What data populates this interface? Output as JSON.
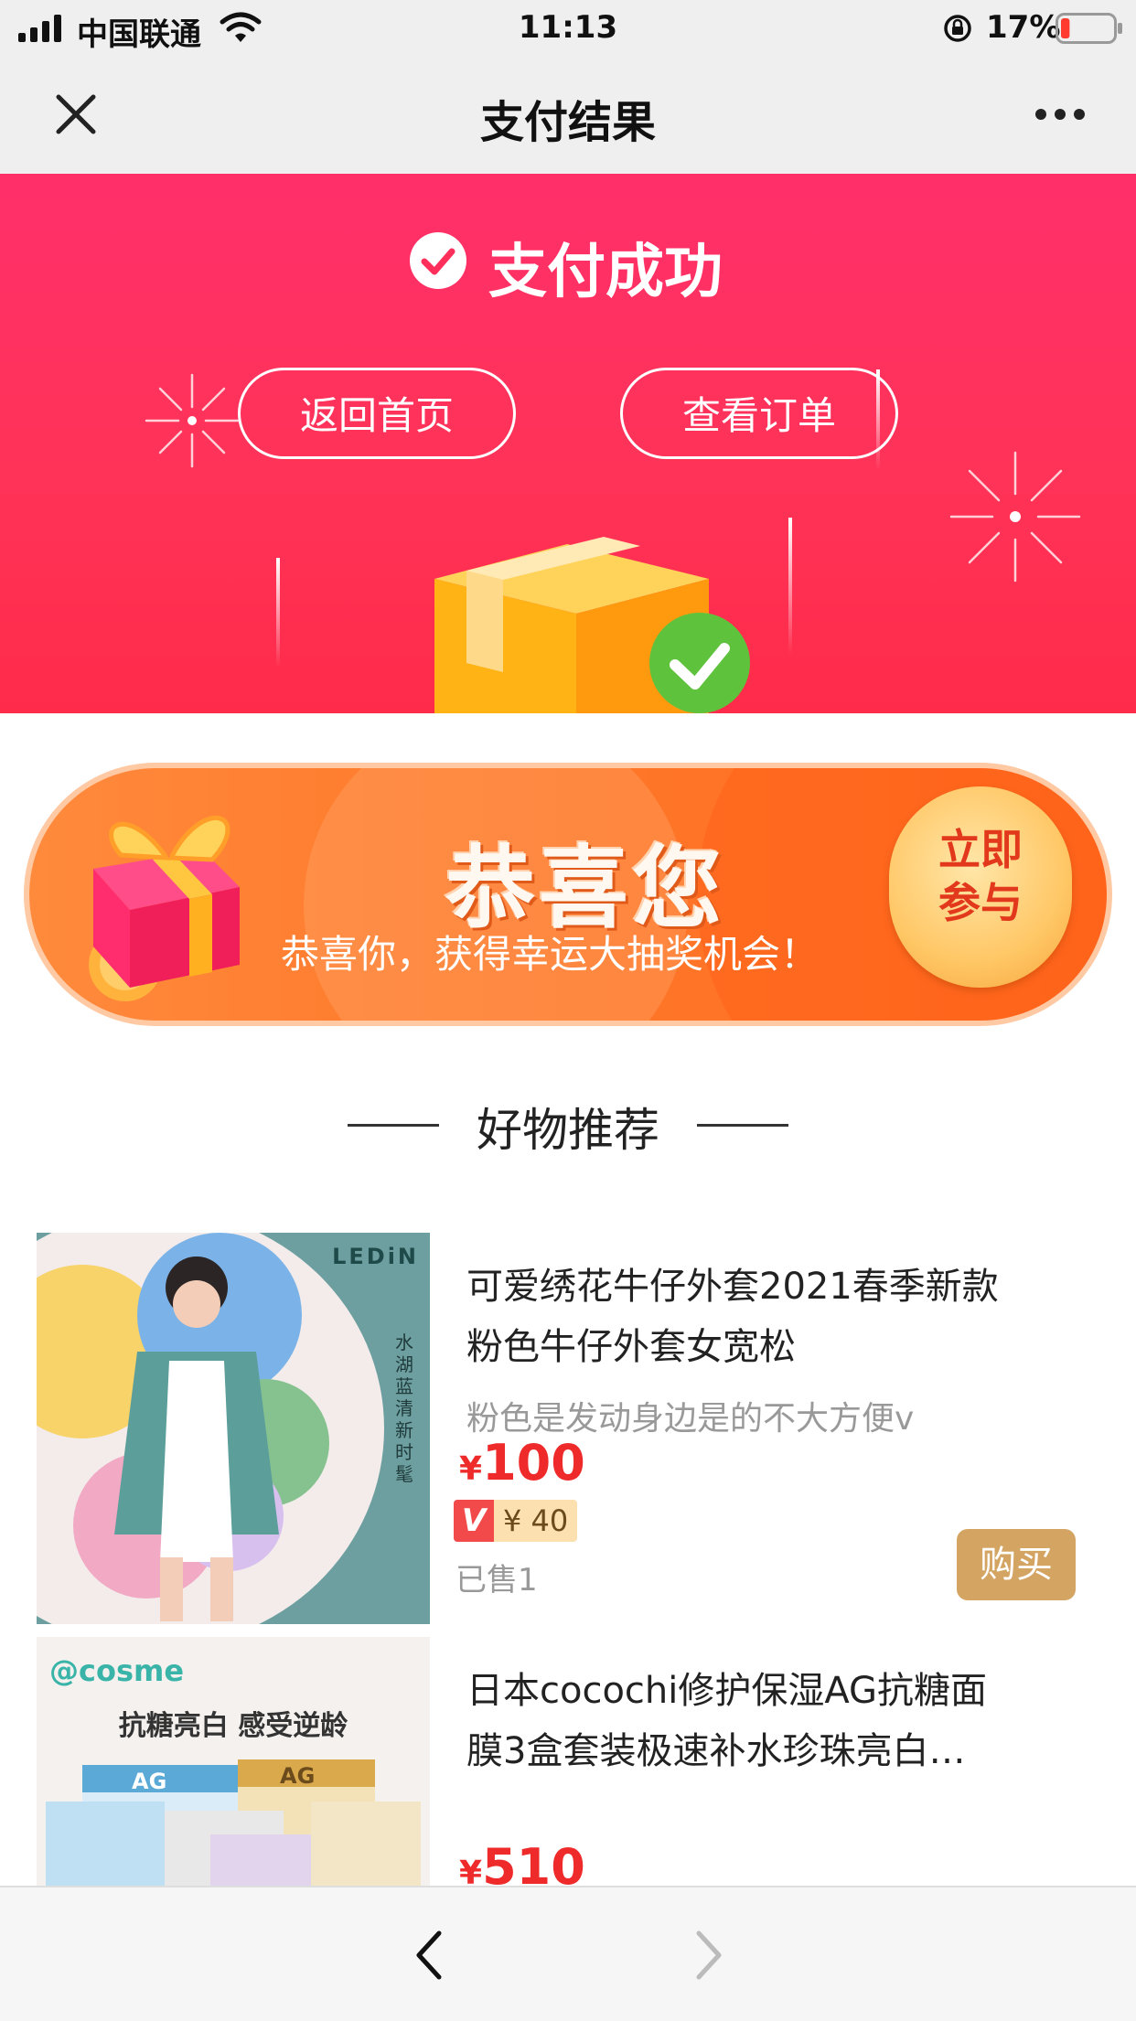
{
  "status_bar": {
    "carrier": "中国联通",
    "time": "11:13",
    "battery": "17%",
    "battery_level": 0.17
  },
  "nav": {
    "title": "支付结果"
  },
  "hero": {
    "status_title": "支付成功",
    "home_button": "返回首页",
    "orders_button": "查看订单"
  },
  "banner": {
    "headline": "恭喜您",
    "subtitle": "恭喜你，获得幸运大抽奖机会！",
    "join_line1": "立即",
    "join_line2": "参与"
  },
  "recommend": {
    "section_title": "好物推荐",
    "products": [
      {
        "image_brand": "LEDiN",
        "image_caption": "水湖蓝 清新时髦",
        "title_line1": "可爱绣花牛仔外套2021春季新款",
        "title_line2": "粉色牛仔外套女宽松",
        "subtitle": "粉色是发动身边是的不大方便v",
        "currency": "¥",
        "price": "100",
        "vip_badge": "V",
        "vip_price": "¥ 40",
        "sold": "已售1",
        "buy_label": "购买"
      },
      {
        "image_brand": "@cosme",
        "image_caption": "抗糖亮白 感受逆龄",
        "image_product_mark": "AG",
        "title_line1": "日本cocochi修护保湿AG抗糖面",
        "title_line2": "膜3盒套装极速补水珍珠亮白…",
        "currency": "¥",
        "price": "510"
      }
    ]
  },
  "toolbar": {
    "back": "back-arrow",
    "forward": "forward-arrow"
  }
}
